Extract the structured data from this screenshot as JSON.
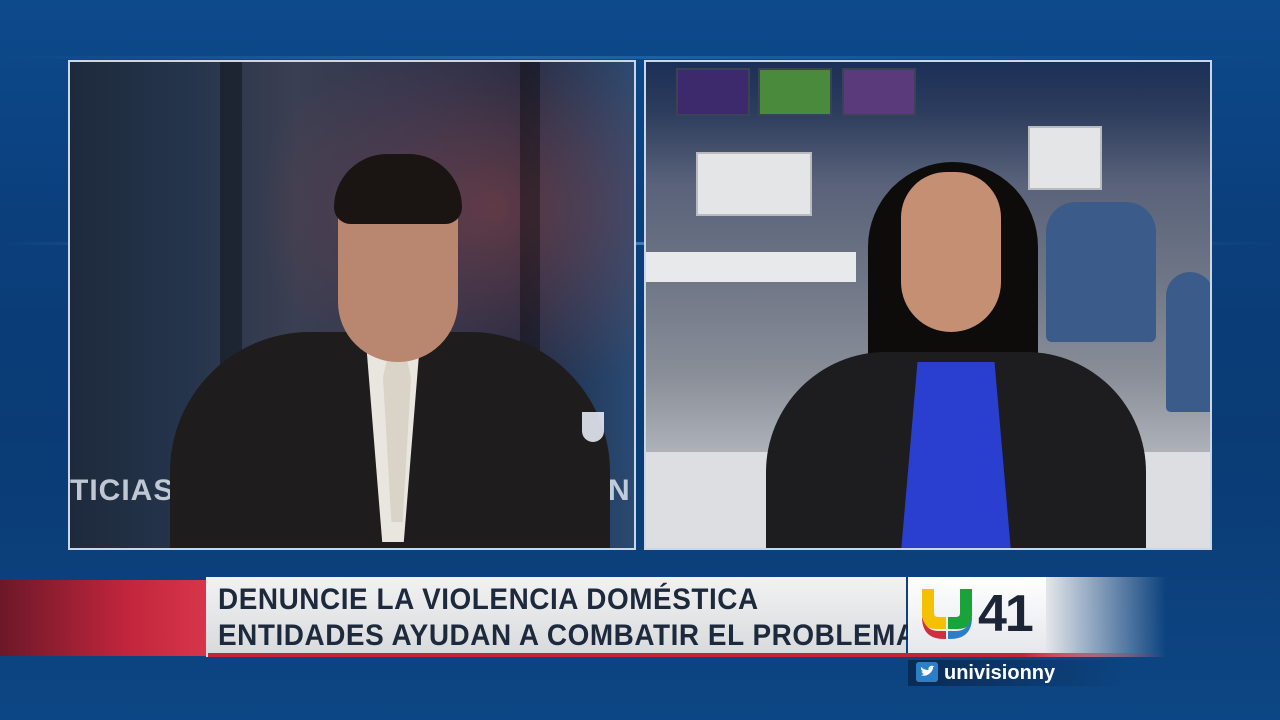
{
  "left_pane": {
    "background_sign": "TICIAS 4",
    "background_sign_tail": "N"
  },
  "lower_third": {
    "headline": "DENUNCIE LA VIOLENCIA DOMÉSTICA",
    "subheadline": "ENTIDADES AYUDAN A COMBATIR EL PROBLEMA",
    "accent_color": "#c1253c"
  },
  "logo": {
    "channel_number": "41",
    "colors": [
      "#f4c100",
      "#1aa33a",
      "#2c7fc7",
      "#d12f3d"
    ]
  },
  "social": {
    "icon": "twitter-bird-icon",
    "handle": "univisionny"
  }
}
